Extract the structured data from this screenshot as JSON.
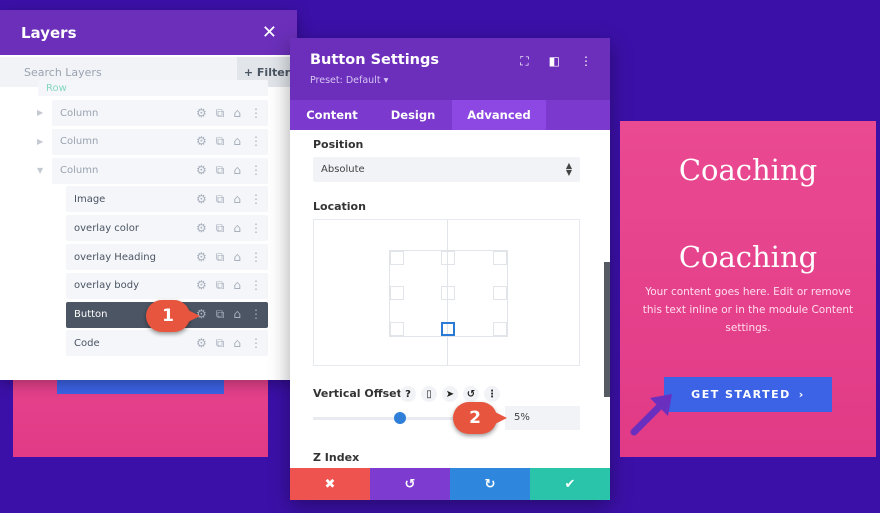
{
  "layers": {
    "title": "Layers",
    "close_icon": "close-icon",
    "search_placeholder": "Search Layers",
    "filter_label": "+ Filter",
    "row_label": "Row",
    "items": [
      {
        "label": "Column",
        "level": 1
      },
      {
        "label": "Column",
        "level": 1
      },
      {
        "label": "Column",
        "level": 1
      },
      {
        "label": "Image",
        "level": 2
      },
      {
        "label": "overlay color",
        "level": 2
      },
      {
        "label": "overlay Heading",
        "level": 2
      },
      {
        "label": "overlay body",
        "level": 2
      },
      {
        "label": "Button",
        "level": 2,
        "selected": true
      },
      {
        "label": "Code",
        "level": 2
      }
    ]
  },
  "modal": {
    "title": "Button Settings",
    "preset": "Preset: Default ▾",
    "tabs": [
      {
        "label": "Content"
      },
      {
        "label": "Design"
      },
      {
        "label": "Advanced",
        "active": true
      }
    ],
    "position_label": "Position",
    "position_value": "Absolute",
    "location_label": "Location",
    "location_selected": "bottom-center",
    "vertical_offset_label": "Vertical Offset",
    "vertical_offset_value": "5%",
    "vertical_offset_slider_percent": 45,
    "z_index_label": "Z Index",
    "footer": {
      "cancel_color": "#ef5350",
      "undo_color": "#7e3bd0",
      "redo_color": "#2e87dc",
      "save_color": "#29c4a9"
    }
  },
  "callouts": [
    "1",
    "2"
  ],
  "preview": {
    "heading1": "Coaching",
    "heading2": "Coaching",
    "body": "Your content goes here. Edit or remove this text inline or in the module Content settings.",
    "button": "GET STARTED",
    "button_chevron": "›"
  },
  "colors": {
    "background": "#3b10a8",
    "accent": "#6c2fbc",
    "card": "#e8448f",
    "button": "#3c63e6"
  }
}
